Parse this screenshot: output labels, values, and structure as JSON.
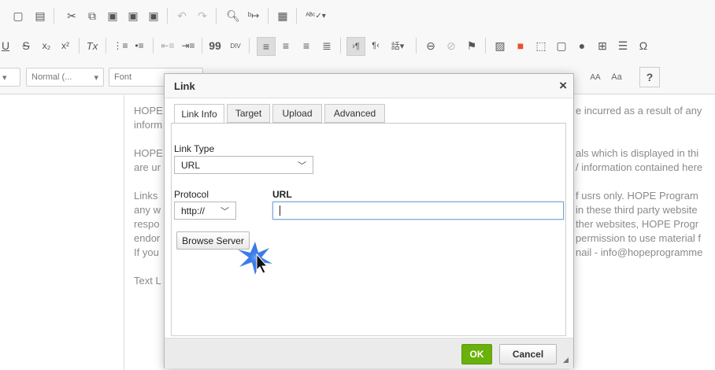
{
  "toolbar2": {
    "italic_clear": "Tx",
    "quote": "99",
    "div": "DIV"
  },
  "toolbar3": {
    "style_combo": "Normal (...",
    "font_combo": "Font",
    "size_a": "AA",
    "size_b": "Aa",
    "help": "?"
  },
  "document": {
    "col_left": [
      "HOPE",
      "inform",
      "",
      "HOPE",
      "are ur",
      "",
      "Links",
      "any w",
      "respo",
      "endor",
      "If you",
      "",
      "Text L"
    ],
    "col_right": [
      "e incurred as a result of any",
      "",
      "",
      "als which is displayed in thi",
      "/ information contained here",
      "",
      "f usrs only. HOPE Program",
      "in these third party website",
      "ther websites, HOPE Progr",
      "permission to use material f",
      "nail - info@hopeprogramme"
    ]
  },
  "dialog": {
    "title": "Link",
    "close": "×",
    "tabs": [
      "Link Info",
      "Target",
      "Upload",
      "Advanced"
    ],
    "link_type_label": "Link Type",
    "link_type_value": "URL",
    "protocol_label": "Protocol",
    "protocol_value": "http://",
    "url_label": "URL",
    "url_value": "",
    "browse_label": "Browse Server",
    "ok_label": "OK",
    "cancel_label": "Cancel"
  },
  "colors": {
    "ok_green": "#69b10b",
    "cursor_highlight": "#2f6fe0",
    "input_focus": "#7aa6d6"
  }
}
